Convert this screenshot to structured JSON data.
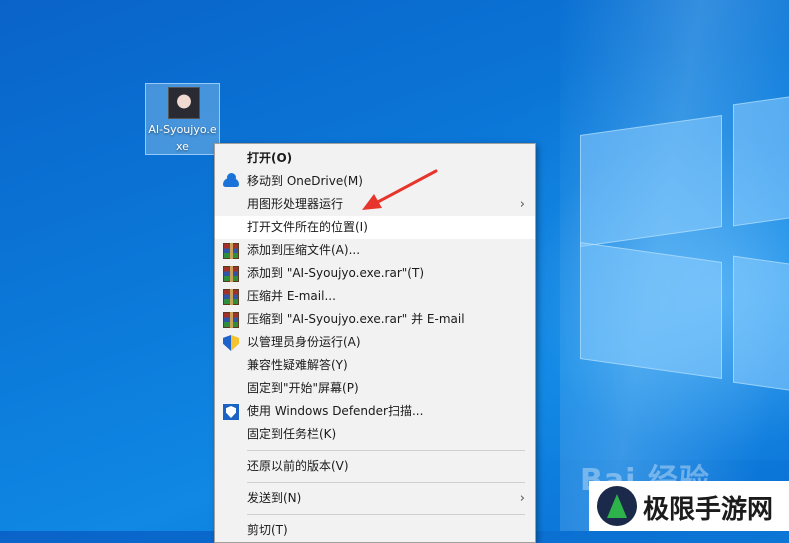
{
  "desktop": {
    "file_icon_label": "AI-Syoujyo.exe"
  },
  "context_menu": {
    "items": [
      {
        "label": "打开(O)",
        "icon": "",
        "bold": true
      },
      {
        "label": "移动到 OneDrive(M)",
        "icon": "onedrive-icon"
      },
      {
        "label": "用图形处理器运行",
        "icon": "",
        "submenu": true
      },
      {
        "label": "打开文件所在的位置(I)",
        "icon": "",
        "highlighted": true
      },
      {
        "label": "添加到压缩文件(A)...",
        "icon": "winrar-icon"
      },
      {
        "label": "添加到 \"AI-Syoujyo.exe.rar\"(T)",
        "icon": "winrar-icon"
      },
      {
        "label": "压缩并 E-mail...",
        "icon": "winrar-icon"
      },
      {
        "label": "压缩到 \"AI-Syoujyo.exe.rar\" 并 E-mail",
        "icon": "winrar-icon"
      },
      {
        "label": "以管理员身份运行(A)",
        "icon": "uac-shield-icon"
      },
      {
        "label": "兼容性疑难解答(Y)",
        "icon": ""
      },
      {
        "label": "固定到\"开始\"屏幕(P)",
        "icon": ""
      },
      {
        "label": "使用 Windows Defender扫描...",
        "icon": "windows-defender-icon"
      },
      {
        "label": "固定到任务栏(K)",
        "icon": ""
      },
      {
        "label": "还原以前的版本(V)",
        "icon": ""
      },
      {
        "label": "发送到(N)",
        "icon": "",
        "submenu": true
      },
      {
        "label": "剪切(T)",
        "icon": ""
      }
    ],
    "submenu_arrow": "›"
  },
  "watermarks": {
    "baidu": "Bai 经验",
    "site_logo": "极限手游网"
  },
  "colors": {
    "desktop_blue": "#0b78d8",
    "menu_bg": "#f2f2f2",
    "annotation_red": "#e8352b"
  }
}
